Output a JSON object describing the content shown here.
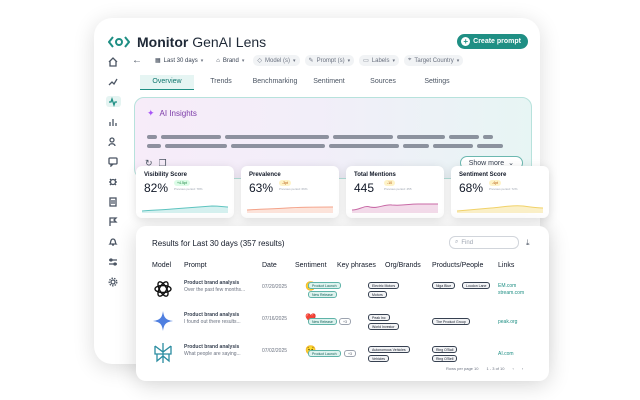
{
  "app": {
    "title_bold": "Monitor",
    "title_rest": "GenAI Lens",
    "create_button": "Create prompt"
  },
  "sidebar": {
    "icons": [
      "home-icon",
      "trend-icon",
      "pulse-icon",
      "bar-chart-icon",
      "users-icon",
      "chat-icon",
      "bug-icon",
      "report-icon",
      "flag-icon",
      "bell-icon",
      "sliders-icon",
      "gear-icon"
    ]
  },
  "filters": {
    "date": "Last 30 days",
    "brand": "Brand",
    "model": "Model (s)",
    "prompt": "Prompt (s)",
    "labels": "Labels",
    "country": "Target Country"
  },
  "tabs": [
    "Overview",
    "Trends",
    "Benchmarking",
    "Sentiment",
    "Sources",
    "Settings"
  ],
  "ai_insights": {
    "title": "AI Insights",
    "show_more": "Show more"
  },
  "metrics": [
    {
      "label": "Visibility Score",
      "value": "82%",
      "badge": "+4.5pt",
      "badge_color": "#dcfce7",
      "badge_text": "#15803d",
      "sub": "Previous period: 78%",
      "line": "#5fc4c0",
      "fill": "#d6f1f0"
    },
    {
      "label": "Prevalence",
      "value": "63%",
      "badge": "-3pt",
      "badge_color": "#fef3c7",
      "badge_text": "#b45309",
      "sub": "Previous period: 66%",
      "line": "#f4a38a",
      "fill": "#fde4db"
    },
    {
      "label": "Total Mentions",
      "value": "445",
      "badge": "-10",
      "badge_color": "#fef3c7",
      "badge_text": "#b45309",
      "sub": "Previous period: 455",
      "line": "#c86aa6",
      "fill": "#f3dbea"
    },
    {
      "label": "Sentiment Score",
      "value": "68%",
      "badge": "-4pt",
      "badge_color": "#fef3c7",
      "badge_text": "#b45309",
      "sub": "Previous period: 72%",
      "line": "#f1d26a",
      "fill": "#fbf0c8"
    }
  ],
  "results": {
    "title": "Results for Last 30 days (357 results)",
    "find_placeholder": "Find",
    "columns": [
      "Model",
      "Prompt",
      "Date",
      "Sentiment",
      "Key phrases",
      "Org/Brands",
      "Products/People",
      "Links"
    ],
    "rows": [
      {
        "model": "openai-icon",
        "prompt_title": "Product brand analysis",
        "prompt_sub": "Over the past few months...",
        "date": "07/20/2025",
        "sentiment": "😐",
        "key_phrases": [
          "Product Launch",
          "New Release",
          "+3"
        ],
        "orgs": [
          "Electric Motors",
          "Motors"
        ],
        "products": [
          "Niga Blue",
          "Loudon Lane"
        ],
        "links": [
          "EM.com",
          "stream.com"
        ]
      },
      {
        "model": "gemini-icon",
        "prompt_title": "Product brand analysis",
        "prompt_sub": "I found out there results...",
        "date": "07/16/2025",
        "sentiment": "❤️",
        "key_phrases": [
          "New Release",
          "+3"
        ],
        "orgs": [
          "Peak Inc",
          "World Investor"
        ],
        "products": [
          "The Product Group"
        ],
        "links": [
          "peak.org"
        ]
      },
      {
        "model": "perplexity-icon",
        "prompt_title": "Product brand analysis",
        "prompt_sub": "What people are saying...",
        "date": "07/02/2025",
        "sentiment": "😟",
        "key_phrases": [
          "Product Launch",
          "+3"
        ],
        "orgs": [
          "Autonomous Vehicles",
          "Vehicles"
        ],
        "products": [
          "Ring O'Ball",
          "Ring O'Bell"
        ],
        "links": [
          "AI.com"
        ]
      }
    ],
    "footer_rows": "Rows per page 10",
    "footer_range": "1 - 3 of 10"
  }
}
